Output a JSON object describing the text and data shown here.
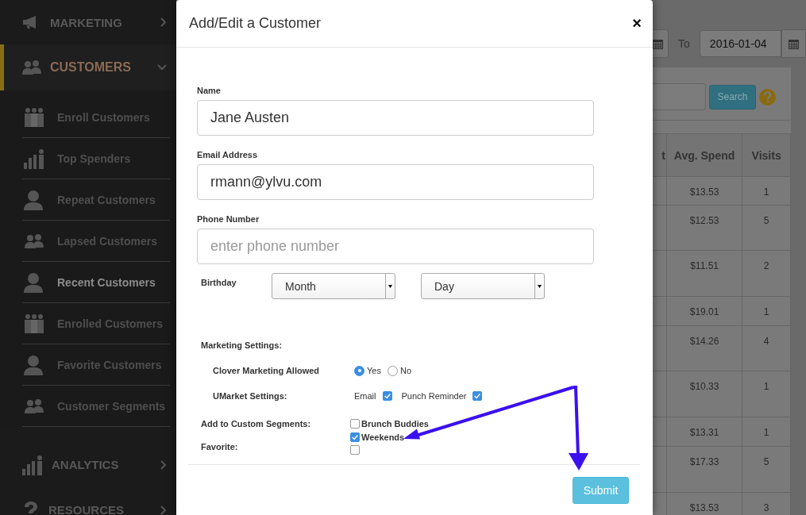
{
  "sidebar": {
    "items": [
      {
        "label": "MARKETING",
        "selected": false,
        "expanded": false
      },
      {
        "label": "CUSTOMERS",
        "selected": true,
        "expanded": true,
        "children": [
          {
            "label": "Enroll Customers",
            "selected": false
          },
          {
            "label": "Top Spenders",
            "selected": false
          },
          {
            "label": "Repeat Customers",
            "selected": false
          },
          {
            "label": "Lapsed Customers",
            "selected": false
          },
          {
            "label": "Recent Customers",
            "selected": true
          },
          {
            "label": "Enrolled Customers",
            "selected": false
          },
          {
            "label": "Favorite Customers",
            "selected": false
          },
          {
            "label": "Customer Segments",
            "selected": false
          }
        ]
      },
      {
        "label": "ANALYTICS",
        "selected": false,
        "expanded": false
      },
      {
        "label": "RESOURCES",
        "selected": false,
        "expanded": false
      }
    ]
  },
  "modal": {
    "title": "Add/Edit a Customer",
    "close": "×",
    "fields": [
      {
        "label": "Name",
        "value": "Jane Austen"
      },
      {
        "label": "Email Address",
        "value": "rmann@ylvu.com"
      },
      {
        "label": "Phone Number",
        "placeholder": "enter phone number"
      }
    ],
    "birthday": {
      "label": "Birthday",
      "selects": [
        "Month",
        "Day"
      ]
    },
    "marketing_heading": "Marketing Settings:",
    "clover": {
      "label": "Clover Marketing Allowed",
      "options": [
        {
          "label": "Yes",
          "selected": true
        },
        {
          "label": "No",
          "selected": false
        }
      ]
    },
    "umarket": {
      "label": "UMarket Settings:",
      "options": [
        {
          "label": "Email",
          "checked": true
        },
        {
          "label": "Punch Reminder",
          "checked": true
        }
      ]
    },
    "segments": {
      "label": "Add to Custom Segments:",
      "options": [
        {
          "label": "Brunch Buddies",
          "checked": false
        },
        {
          "label": "Weekends",
          "checked": true
        }
      ]
    },
    "favorite": {
      "label": "Favorite:",
      "checked": false
    },
    "submit": "Submit"
  },
  "background": {
    "date_to": {
      "label": "To",
      "value": "2016-01-04"
    },
    "search_button": "Search",
    "table": {
      "columns": [
        "t",
        "Avg. Spend",
        "Visits"
      ],
      "rows": [
        {
          "avg_spend": "$13.53",
          "visits": "1"
        },
        {
          "avg_spend": "$12.53",
          "visits": "5"
        },
        {
          "avg_spend": "$11.51",
          "visits": "2"
        },
        {
          "avg_spend": "$19.01",
          "visits": "1"
        },
        {
          "avg_spend": "$14.26",
          "visits": "4"
        },
        {
          "avg_spend": "$10.33",
          "visits": "1"
        },
        {
          "avg_spend": "$13.31",
          "visits": "1"
        },
        {
          "avg_spend": "$17.33",
          "visits": "5"
        },
        {
          "avg_spend": "$13.53",
          "visits": "3"
        }
      ]
    }
  }
}
